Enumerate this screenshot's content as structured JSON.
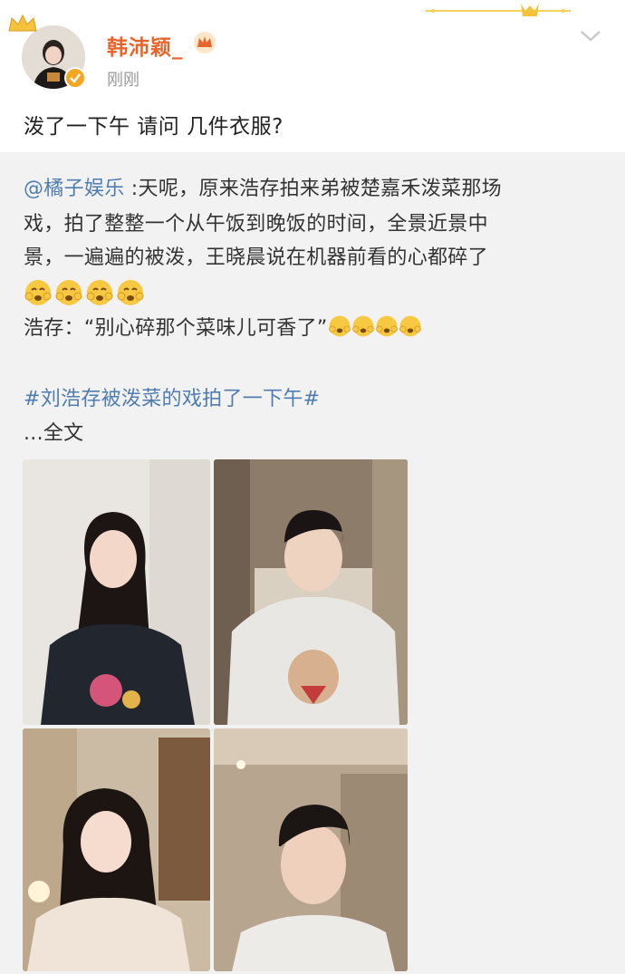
{
  "post": {
    "author": "韩沛颖_",
    "time": "刚刚",
    "text": "泼了一下午 请问 几件衣服?"
  },
  "retweet": {
    "mention": "@橘子娱乐",
    "line1_rest": " :天呢，原来浩存拍来弟被楚嘉禾泼菜那场",
    "line2": "戏，拍了整整一个从午饭到晚饭的时间，全景近景中",
    "line3": "景，一遍遍的被泼，王晓晨说在机器前看的心都碎了",
    "quote": "浩存：“别心碎那个菜味儿可香了”",
    "hashtag": "#刘浩存被泼菜的戏拍了一下午#",
    "more": "...全文"
  },
  "colors": {
    "username": "#e8642b",
    "link": "#507daf",
    "retweet_bg": "#f2f2f2",
    "verified": "#f5a623"
  },
  "icons": [
    "crown-decoration-icon",
    "crown-badge-icon",
    "verified-icon",
    "chevron-down-icon",
    "crying-emoji-icon"
  ]
}
